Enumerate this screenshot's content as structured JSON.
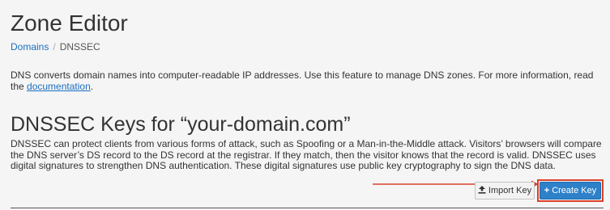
{
  "page": {
    "title": "Zone Editor"
  },
  "breadcrumb": {
    "items": [
      {
        "label": "Domains"
      },
      {
        "label": "DNSSEC"
      }
    ],
    "separator": "/"
  },
  "intro": {
    "text": "DNS converts domain names into computer-readable IP addresses. Use this feature to manage DNS zones. For more information, read the ",
    "link_label": "documentation",
    "suffix": "."
  },
  "section": {
    "title": "DNSSEC Keys for “your-domain.com”",
    "description": "DNSSEC can protect clients from various forms of attack, such as Spoofing or a Man-in-the-Middle attack. Visitors’ browsers will compare the DNS server’s DS record to the DS record at the registrar. If they match, then the visitor knows that the record is valid. DNSSEC uses digital signatures to strengthen DNS authentication. These digital signatures use public key cryptography to sign the DNS data."
  },
  "toolbar": {
    "import_label": "Import Key",
    "import_icon": "upload-icon",
    "create_label": "Create Key",
    "create_icon": "plus-icon"
  },
  "colors": {
    "link": "#1a6fc1",
    "primary_button": "#2e81c9",
    "annotation": "#d9412b",
    "background": "#f5f5f5"
  }
}
